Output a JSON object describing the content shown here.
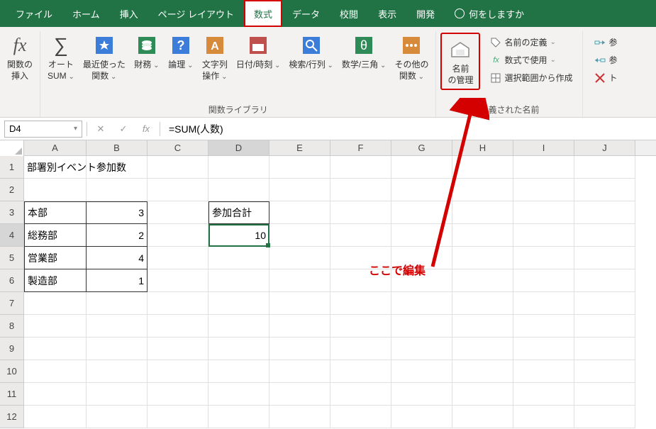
{
  "menu": {
    "file": "ファイル",
    "home": "ホーム",
    "insert": "挿入",
    "page_layout": "ページ レイアウト",
    "formulas": "数式",
    "data": "データ",
    "review": "校閲",
    "view": "表示",
    "developer": "開発",
    "tell_me": "何をしますか"
  },
  "ribbon": {
    "insert_function_l1": "関数の",
    "insert_function_l2": "挿入",
    "autosum_l1": "オート",
    "autosum_l2": "SUM",
    "recent_l1": "最近使った",
    "recent_l2": "関数",
    "financial": "財務",
    "logical": "論理",
    "text_l1": "文字列",
    "text_l2": "操作",
    "datetime": "日付/時刻",
    "lookup": "検索/行列",
    "math": "数学/三角",
    "more_l1": "その他の",
    "more_l2": "関数",
    "name1": "名前",
    "name2": "の管理",
    "define_name": "名前の定義",
    "use_in_formula": "数式で使用",
    "create_from_sel": "選択範囲から作成",
    "trace_p": "参",
    "trace_d": "参",
    "trace_r": "ト",
    "group_library": "関数ライブラリ",
    "group_names": "定義された名前"
  },
  "formula_bar": {
    "name_box": "D4",
    "fx": "fx",
    "formula": "=SUM(人数)"
  },
  "columns": [
    "A",
    "B",
    "C",
    "D",
    "E",
    "F",
    "G",
    "H",
    "I",
    "J"
  ],
  "rows": [
    "1",
    "2",
    "3",
    "4",
    "5",
    "6",
    "7",
    "8",
    "9",
    "10",
    "11",
    "12"
  ],
  "cells": {
    "A1": "部署別イベント参加数",
    "A3": "本部",
    "B3": "3",
    "A4": "総務部",
    "B4": "2",
    "A5": "営業部",
    "B5": "4",
    "A6": "製造部",
    "B6": "1",
    "D3": "参加合計",
    "D4": "10"
  },
  "annotation": {
    "edit_here": "ここで編集"
  }
}
